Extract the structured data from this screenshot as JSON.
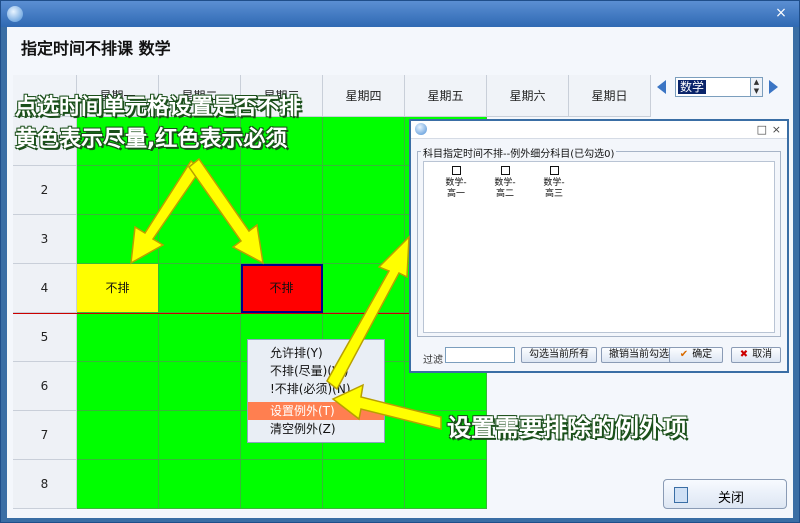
{
  "window": {
    "title_close": "×"
  },
  "page_title": "指定时间不排课 数学",
  "grid": {
    "columns": [
      "星期一",
      "星期二",
      "星期三",
      "星期四",
      "星期五",
      "星期六",
      "星期日"
    ],
    "rows": [
      "1",
      "2",
      "3",
      "4",
      "5",
      "6",
      "7",
      "8"
    ],
    "marked": [
      {
        "row": "4",
        "day": "星期一",
        "label": "不排",
        "level": "尽量"
      },
      {
        "row": "4",
        "day": "星期三",
        "label": "不排",
        "level": "必须"
      }
    ],
    "colors": {
      "allowed": "#00ff00",
      "prefer_not": "#ffff00",
      "must_not": "#ff0000"
    }
  },
  "subject_selector": {
    "value": "数学"
  },
  "close_button": {
    "label": "关闭"
  },
  "context_menu": {
    "items": [
      "允许排(Y)",
      "不排(尽量)(W)",
      "!不排(必须)(N)",
      "设置例外(T)",
      "清空例外(Z)"
    ],
    "highlighted_index": 3
  },
  "dialog": {
    "min": "□",
    "close": "×",
    "group_title": "科目指定时间不排--例外细分科目(已勾选0)",
    "subjects": [
      {
        "name": "数学-",
        "grade": "高一"
      },
      {
        "name": "数学-",
        "grade": "高二"
      },
      {
        "name": "数学-",
        "grade": "高三"
      }
    ],
    "filter_label": "过滤",
    "select_all_label": "勾选当前所有",
    "unselect_all_label": "撤销当前勾选",
    "ok_label": "确定",
    "cancel_label": "取消"
  },
  "annotations": {
    "line1": "点选时间单元格设置是否不排",
    "line2": "黄色表示尽量,红色表示必须",
    "bottom": "设置需要排除的例外项"
  }
}
